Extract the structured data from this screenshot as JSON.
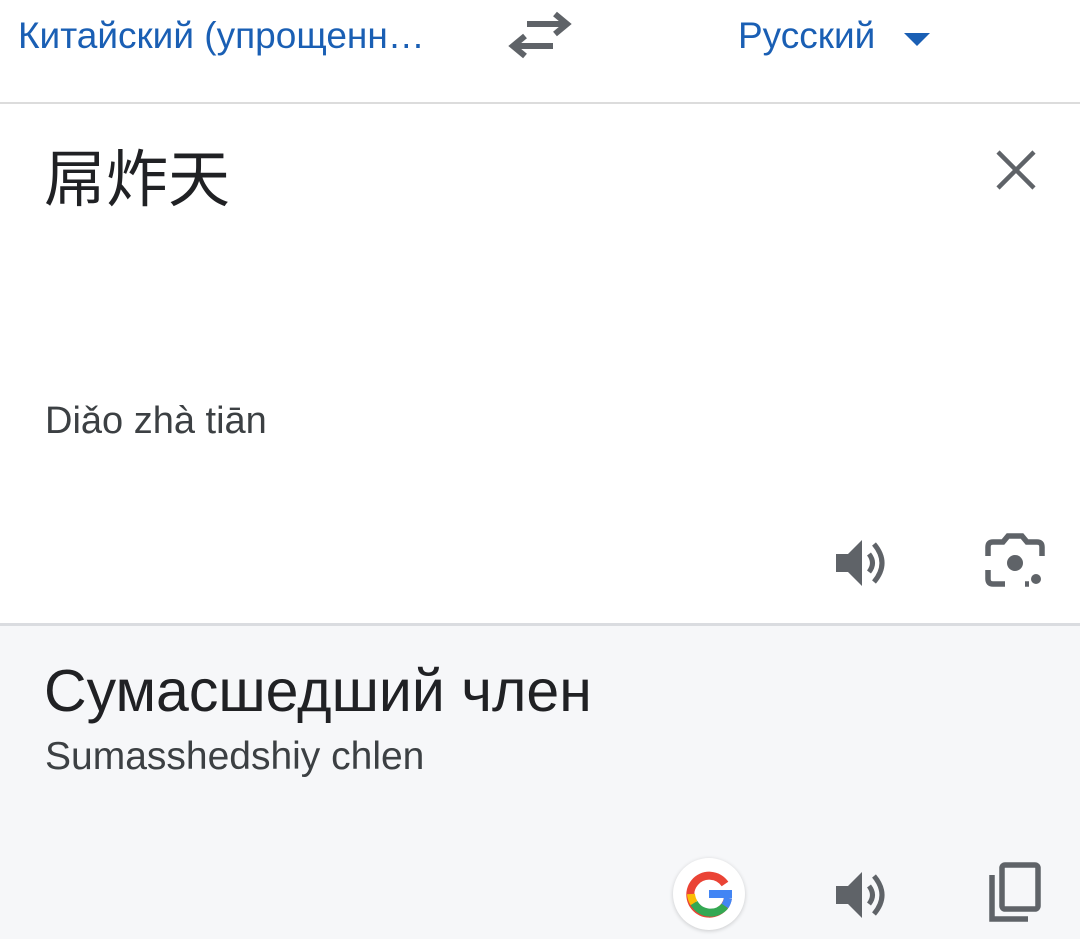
{
  "language_bar": {
    "source_language": "Китайский (упрощенн…",
    "target_language": "Русский",
    "swap_icon": "swap-arrows-icon",
    "dropdown_icon": "dropdown-arrow-icon"
  },
  "input": {
    "text": "屌炸天",
    "transliteration": "Diǎo zhà tiān",
    "clear_icon": "close-icon",
    "speak_icon": "speaker-icon",
    "camera_icon": "camera-lens-icon"
  },
  "output": {
    "translation": "Сумасшедший член",
    "transliteration": "Sumasshedshiy chlen",
    "google_icon": "google-g-icon",
    "speak_icon": "speaker-icon",
    "copy_icon": "copy-icon"
  },
  "colors": {
    "accent": "#1a5fb4",
    "icon_gray": "#5f6368",
    "output_background": "#f6f7f9",
    "divider": "#dadce0"
  }
}
